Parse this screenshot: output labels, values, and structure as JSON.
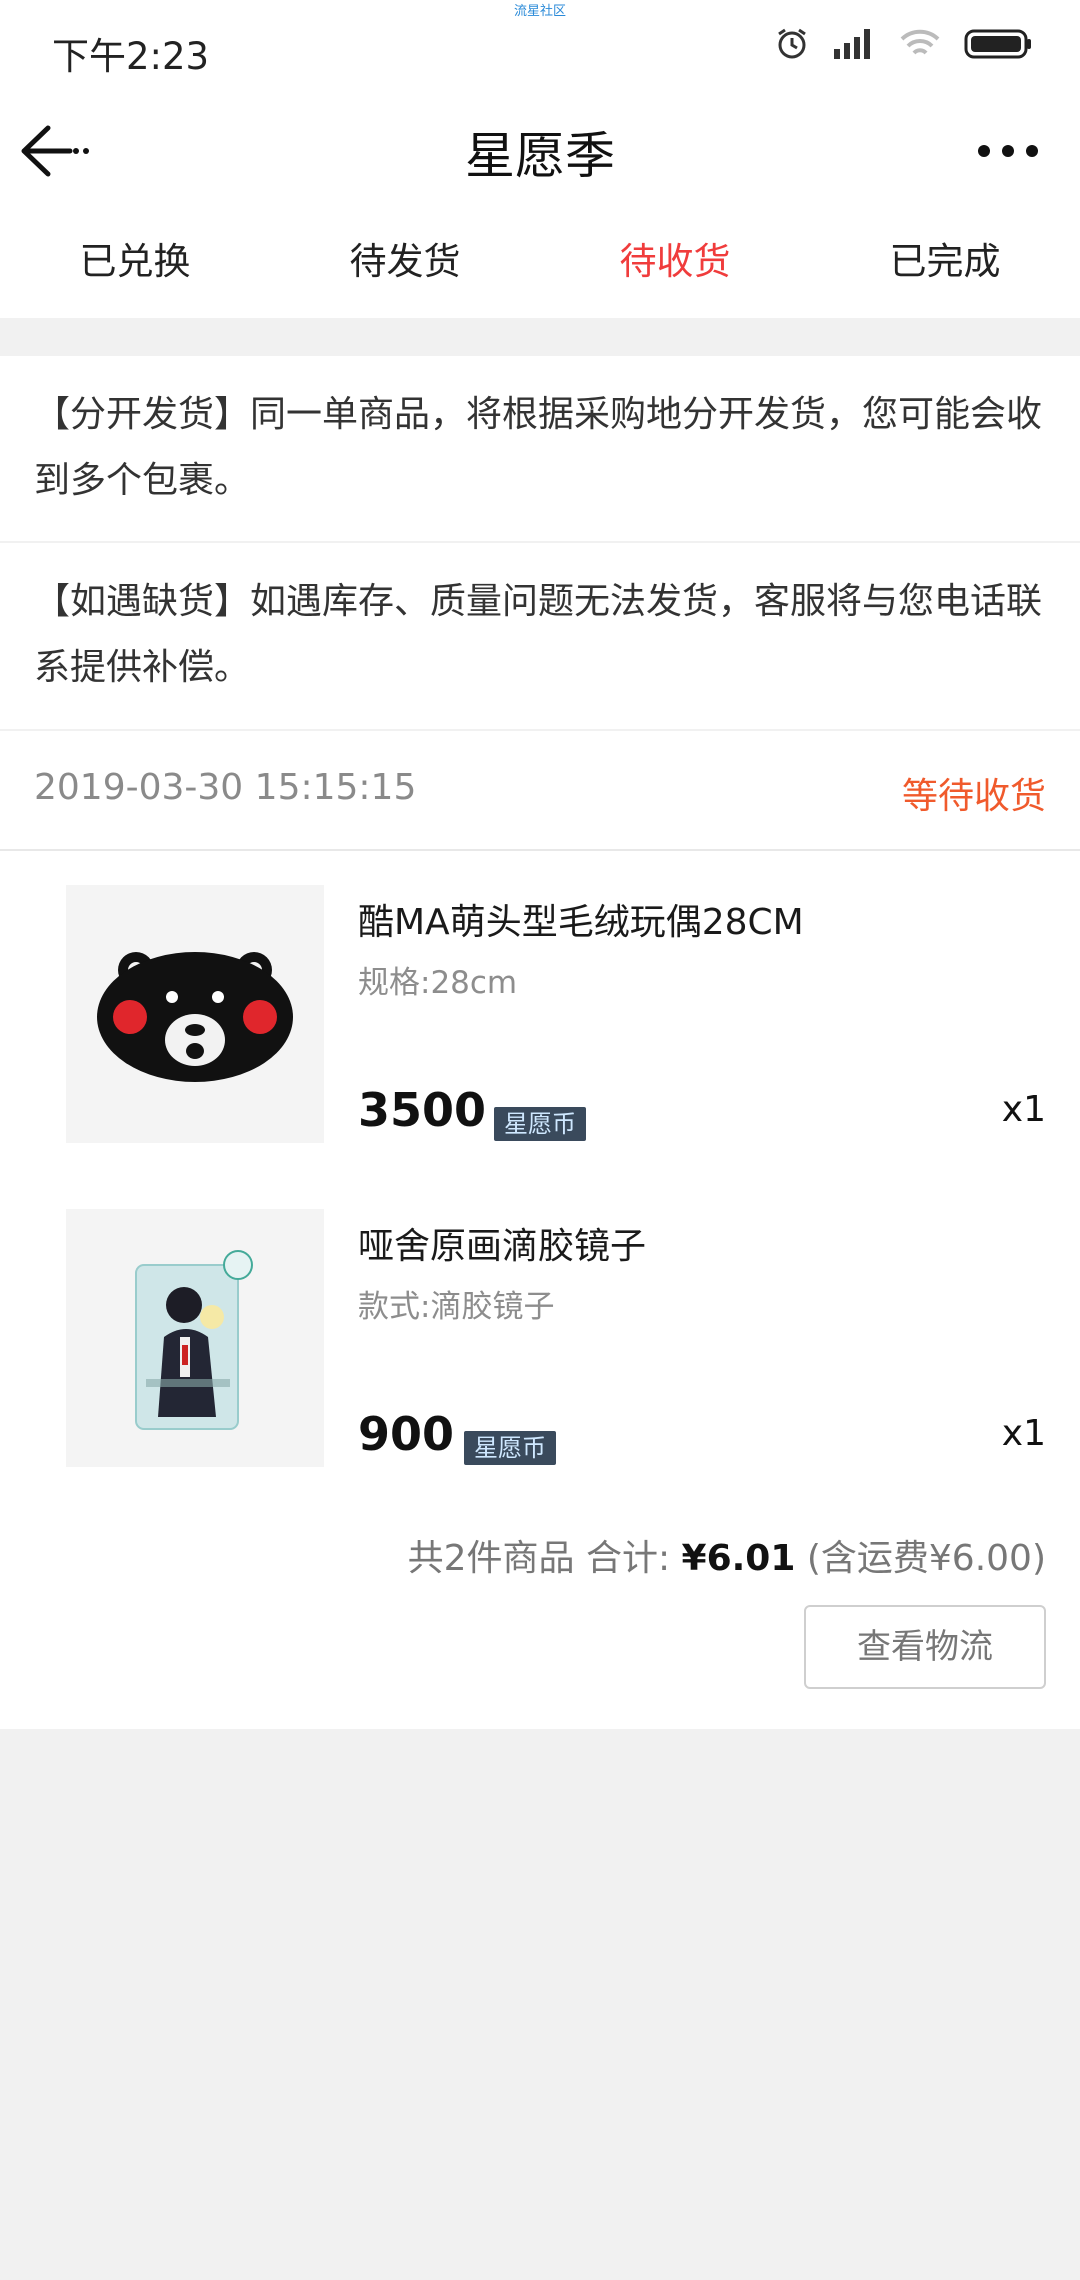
{
  "status_bar": {
    "time": "下午2:23",
    "center_text": "流星社区"
  },
  "nav": {
    "title": "星愿季",
    "back_icon": "back-arrow-icon",
    "more_icon": "more-dots-icon"
  },
  "tabs": [
    {
      "label": "已兑换",
      "active": false
    },
    {
      "label": "待发货",
      "active": false
    },
    {
      "label": "待收货",
      "active": true
    },
    {
      "label": "已完成",
      "active": false
    }
  ],
  "notices": [
    {
      "text": "【分开发货】同一单商品，将根据采购地分开发货，您可能会收到多个包裹。"
    },
    {
      "text": "【如遇缺货】如遇库存、质量问题无法发货，客服将与您电话联系提供补偿。"
    }
  ],
  "order": {
    "datetime": "2019-03-30 15:15:15",
    "status": "等待收货",
    "items": [
      {
        "name": "酷MA萌头型毛绒玩偶28CM",
        "spec": "规格:28cm",
        "price": "3500",
        "currency_badge": "星愿币",
        "qty": "x1"
      },
      {
        "name": "哑舍原画滴胶镜子",
        "spec": "款式:滴胶镜子",
        "price": "900",
        "currency_badge": "星愿币",
        "qty": "x1"
      }
    ],
    "summary_prefix": "共2件商品 合计: ",
    "summary_amount": "¥6.01",
    "summary_suffix": " (含运费¥6.00)",
    "logistics_button": "查看物流"
  },
  "colors": {
    "accent_red": "#f03c3c",
    "status_orange": "#f05a2c",
    "badge_bg": "#3a4a5c"
  }
}
